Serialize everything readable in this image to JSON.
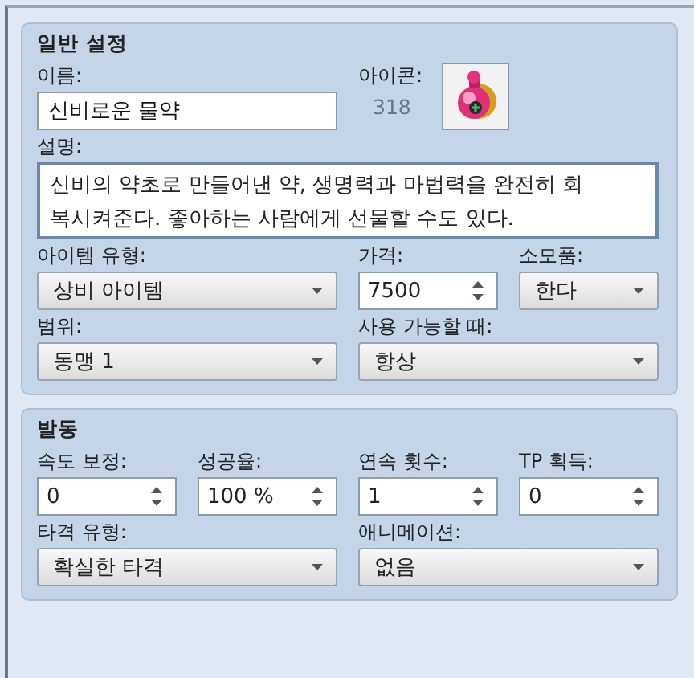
{
  "general": {
    "title": "일반 설정",
    "name": {
      "label": "이름:",
      "value": "신비로운 물약"
    },
    "icon": {
      "label": "아이콘:",
      "index": "318"
    },
    "description": {
      "label": "설명:",
      "value": "신비의 약초로 만들어낸 약, 생명력과 마법력을 완전히 회복시켜준다. 좋아하는 사람에게 선물할 수도 있다."
    },
    "lines": [
      {
        "fields": [
          {
            "label": "아이템 유형:",
            "kind": "select",
            "value": "상비 아이템"
          },
          {
            "label": "가격:",
            "kind": "spinner",
            "value": "7500"
          },
          {
            "label": "소모품:",
            "kind": "select",
            "value": "한다"
          }
        ]
      },
      {
        "fields": [
          {
            "label": "범위:",
            "kind": "select",
            "value": "동맹 1"
          },
          {
            "label": "사용 가능할 때:",
            "kind": "select",
            "value": "항상"
          }
        ]
      }
    ]
  },
  "invocation": {
    "title": "발동",
    "lines": [
      {
        "fields": [
          {
            "label": "속도 보정:",
            "kind": "spinner",
            "value": "0"
          },
          {
            "label": "성공율:",
            "kind": "spinner",
            "value": "100 %"
          },
          {
            "label": "연속 횟수:",
            "kind": "spinner",
            "value": "1"
          },
          {
            "label": "TP 획득:",
            "kind": "spinner",
            "value": "0"
          }
        ]
      },
      {
        "fields": [
          {
            "label": "타격 유형:",
            "kind": "select",
            "value": "확실한 타격"
          },
          {
            "label": "애니메이션:",
            "kind": "select",
            "value": "없음"
          }
        ]
      }
    ]
  }
}
